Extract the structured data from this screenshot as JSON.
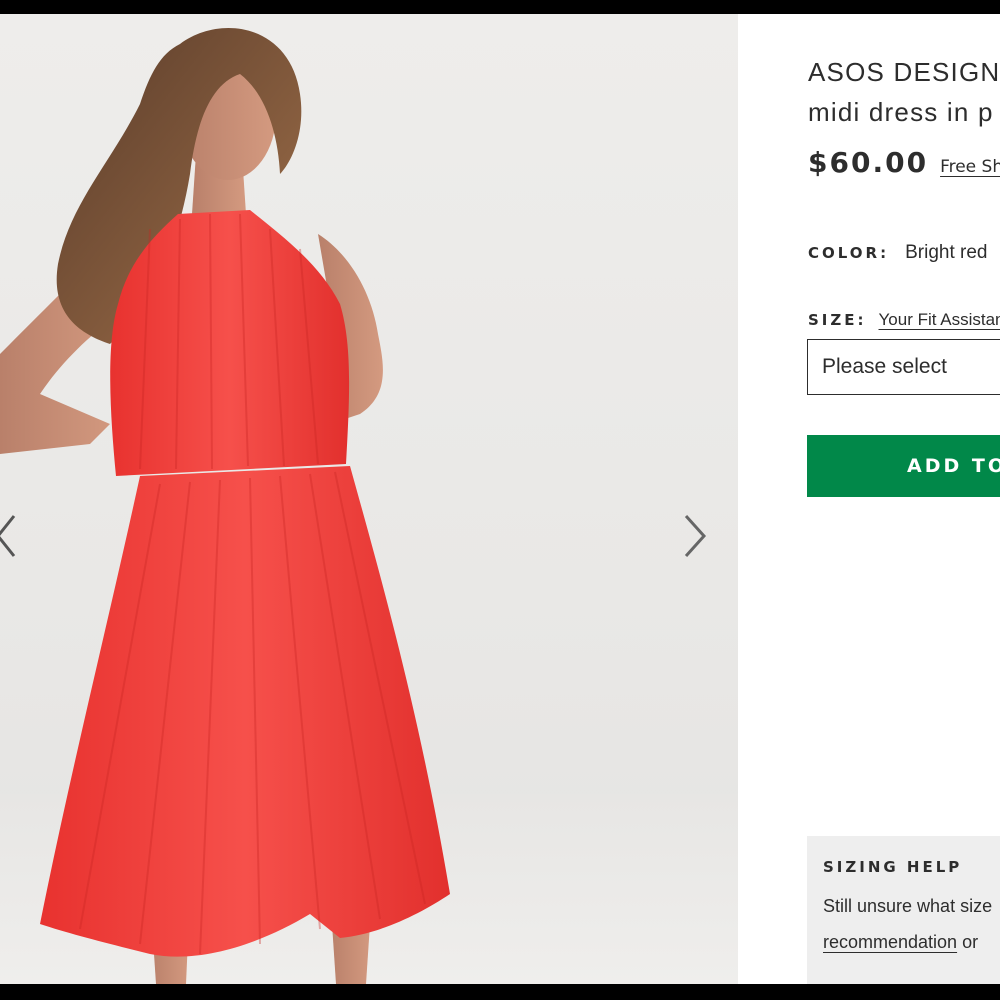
{
  "product": {
    "title_line1": "ASOS DESIGN",
    "title_line2": "midi dress in p",
    "price": "$60.00",
    "shipping_link": "Free Sh",
    "color_label": "COLOR:",
    "color_value": "Bright red",
    "size_label": "SIZE:",
    "fit_assistant_link": "Your Fit Assistan",
    "size_placeholder": "Please select",
    "add_button": "ADD TO"
  },
  "sizing_help": {
    "title": "SIZING HELP",
    "line1": "Still unsure what size",
    "link": "recommendation",
    "line2_suffix": " or"
  },
  "gallery": {
    "prev_icon": "chevron-left-icon",
    "next_icon": "chevron-right-icon",
    "image_subject": "model wearing red pleated halter midi dress"
  },
  "colors": {
    "accent_green": "#018849",
    "dress_red": "#ee3a3a",
    "text": "#2d2d2d",
    "help_bg": "#eeeeee"
  }
}
